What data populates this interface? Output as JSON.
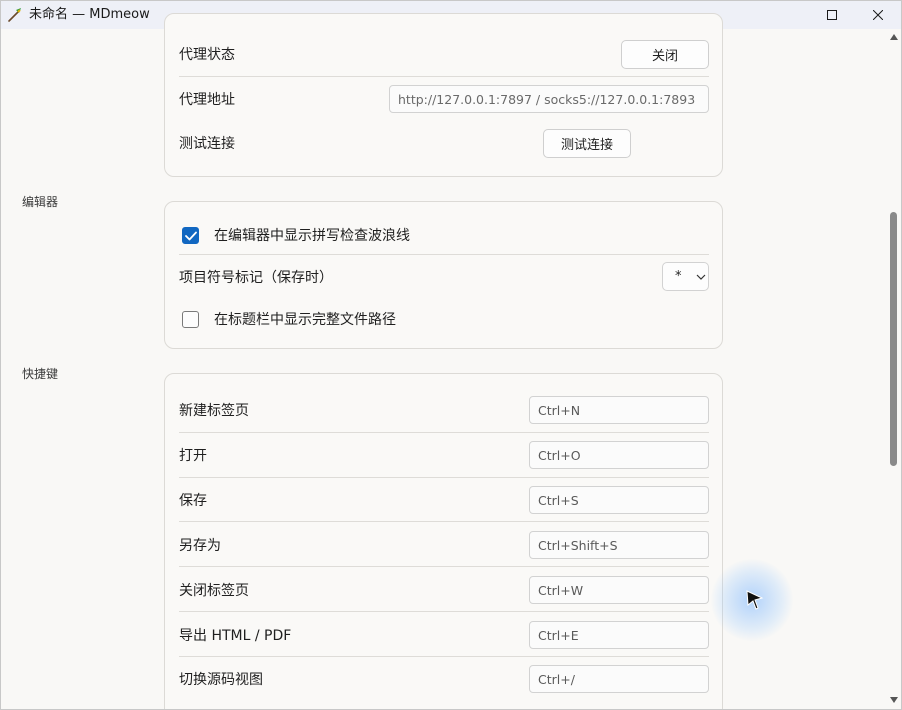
{
  "window": {
    "title": "未命名 — MDmeow"
  },
  "proxy": {
    "status_label": "代理状态",
    "status_button": "关闭",
    "address_label": "代理地址",
    "address_placeholder": "http://127.0.0.1:7897  /  socks5://127.0.0.1:7893",
    "test_label": "测试连接",
    "test_button": "测试连接"
  },
  "editor": {
    "section_title": "编辑器",
    "spellcheck_label": "在编辑器中显示拼写检查波浪线",
    "spellcheck_checked": true,
    "bullet_label": "项目符号标记（保存时）",
    "bullet_value": "*",
    "fullpath_label": "在标题栏中显示完整文件路径",
    "fullpath_checked": false
  },
  "shortcuts": {
    "section_title": "快捷键",
    "items": [
      {
        "label": "新建标签页",
        "key": "Ctrl+N"
      },
      {
        "label": "打开",
        "key": "Ctrl+O"
      },
      {
        "label": "保存",
        "key": "Ctrl+S"
      },
      {
        "label": "另存为",
        "key": "Ctrl+Shift+S"
      },
      {
        "label": "关闭标签页",
        "key": "Ctrl+W"
      },
      {
        "label": "导出 HTML / PDF",
        "key": "Ctrl+E"
      },
      {
        "label": "切换源码视图",
        "key": "Ctrl+/"
      }
    ]
  },
  "colors": {
    "accent": "#1167c1",
    "background": "#f9f8f6",
    "titlebar": "#eef0f7"
  },
  "icons": {
    "app": "quill-pen-icon",
    "maximize": "maximize-icon",
    "close": "close-icon",
    "checkmark": "checkmark-icon",
    "chevron": "chevron-down-icon",
    "cursor": "mouse-pointer-icon"
  }
}
